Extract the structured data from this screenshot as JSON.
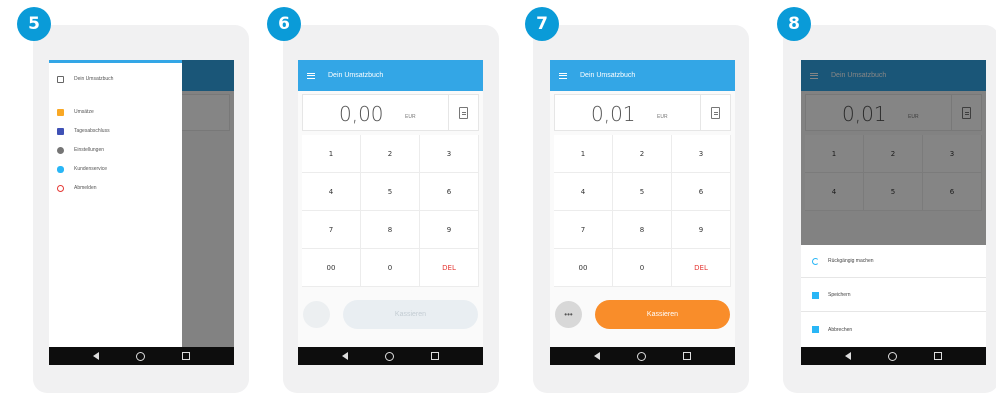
{
  "steps": [
    {
      "number": "5",
      "drawer": {
        "header_label": "Dein Umsatzbuch",
        "items": [
          {
            "label": "Umsätze",
            "icon": "flag-icon",
            "color": "#f9a825"
          },
          {
            "label": "Tagesabschluss",
            "icon": "calendar-icon",
            "color": "#3f51b5"
          },
          {
            "label": "Einstellungen",
            "icon": "gear-icon",
            "color": "#757575"
          },
          {
            "label": "Kundenservice",
            "icon": "phone-icon",
            "color": "#29b6f6"
          },
          {
            "label": "Abmelden",
            "icon": "logout-icon",
            "color": "#e53935"
          }
        ]
      }
    },
    {
      "number": "6",
      "appbar_title": "Dein Umsatzbuch",
      "amount": "0,00",
      "currency": "EUR",
      "keys": [
        "1",
        "2",
        "3",
        "4",
        "5",
        "6",
        "7",
        "8",
        "9",
        "00",
        "0",
        "DEL"
      ],
      "submit_label": "Kassieren",
      "submit_enabled": false
    },
    {
      "number": "7",
      "appbar_title": "Dein Umsatzbuch",
      "amount": "0,01",
      "currency": "EUR",
      "keys": [
        "1",
        "2",
        "3",
        "4",
        "5",
        "6",
        "7",
        "8",
        "9",
        "00",
        "0",
        "DEL"
      ],
      "more_label": "•••",
      "submit_label": "Kassieren",
      "submit_enabled": true
    },
    {
      "number": "8",
      "appbar_title": "Dein Umsatzbuch",
      "amount": "0,01",
      "currency": "EUR",
      "keys": [
        "1",
        "2",
        "3",
        "4",
        "5",
        "6"
      ],
      "sheet": [
        {
          "label": "Rückgängig machen",
          "icon": "undo-icon",
          "color": "#29b6f6"
        },
        {
          "label": "Speichern",
          "icon": "save-icon",
          "color": "#29b6f6"
        },
        {
          "label": "Abbrechen",
          "icon": "document-icon",
          "color": "#29b6f6"
        }
      ]
    }
  ],
  "colors": {
    "badge": "#0a9bd8",
    "appbar": "#33a6e6",
    "accent_orange": "#f98d2a",
    "delete_red": "#e53935"
  }
}
